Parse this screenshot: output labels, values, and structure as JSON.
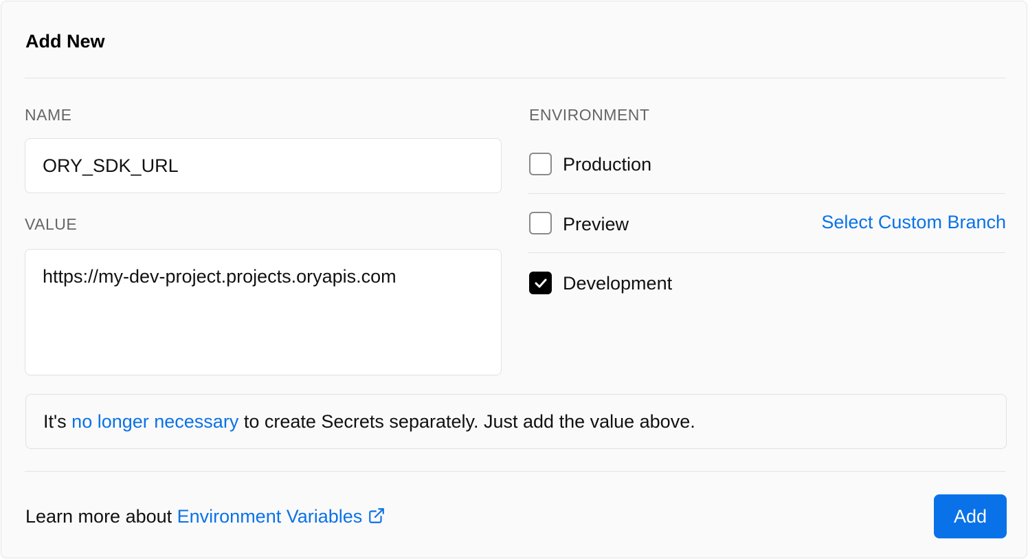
{
  "title": "Add New",
  "name_field": {
    "label": "NAME",
    "value": "ORY_SDK_URL"
  },
  "value_field": {
    "label": "VALUE",
    "value": "https://my-dev-project.projects.oryapis.com"
  },
  "environment": {
    "label": "ENVIRONMENT",
    "options": [
      {
        "label": "Production",
        "checked": false
      },
      {
        "label": "Preview",
        "checked": false
      },
      {
        "label": "Development",
        "checked": true
      }
    ],
    "custom_branch_link": "Select Custom Branch"
  },
  "notice": {
    "prefix": "It's ",
    "link": "no longer necessary",
    "suffix": " to create Secrets separately. Just add the value above."
  },
  "footer": {
    "prefix": "Learn more about ",
    "link": "Environment Variables",
    "icon": "external-link-icon"
  },
  "add_button": "Add",
  "colors": {
    "accent": "#0a72e8",
    "background": "#fafafa",
    "border": "#e1e1e1",
    "label": "#666666",
    "checkbox_checked": "#000000"
  }
}
